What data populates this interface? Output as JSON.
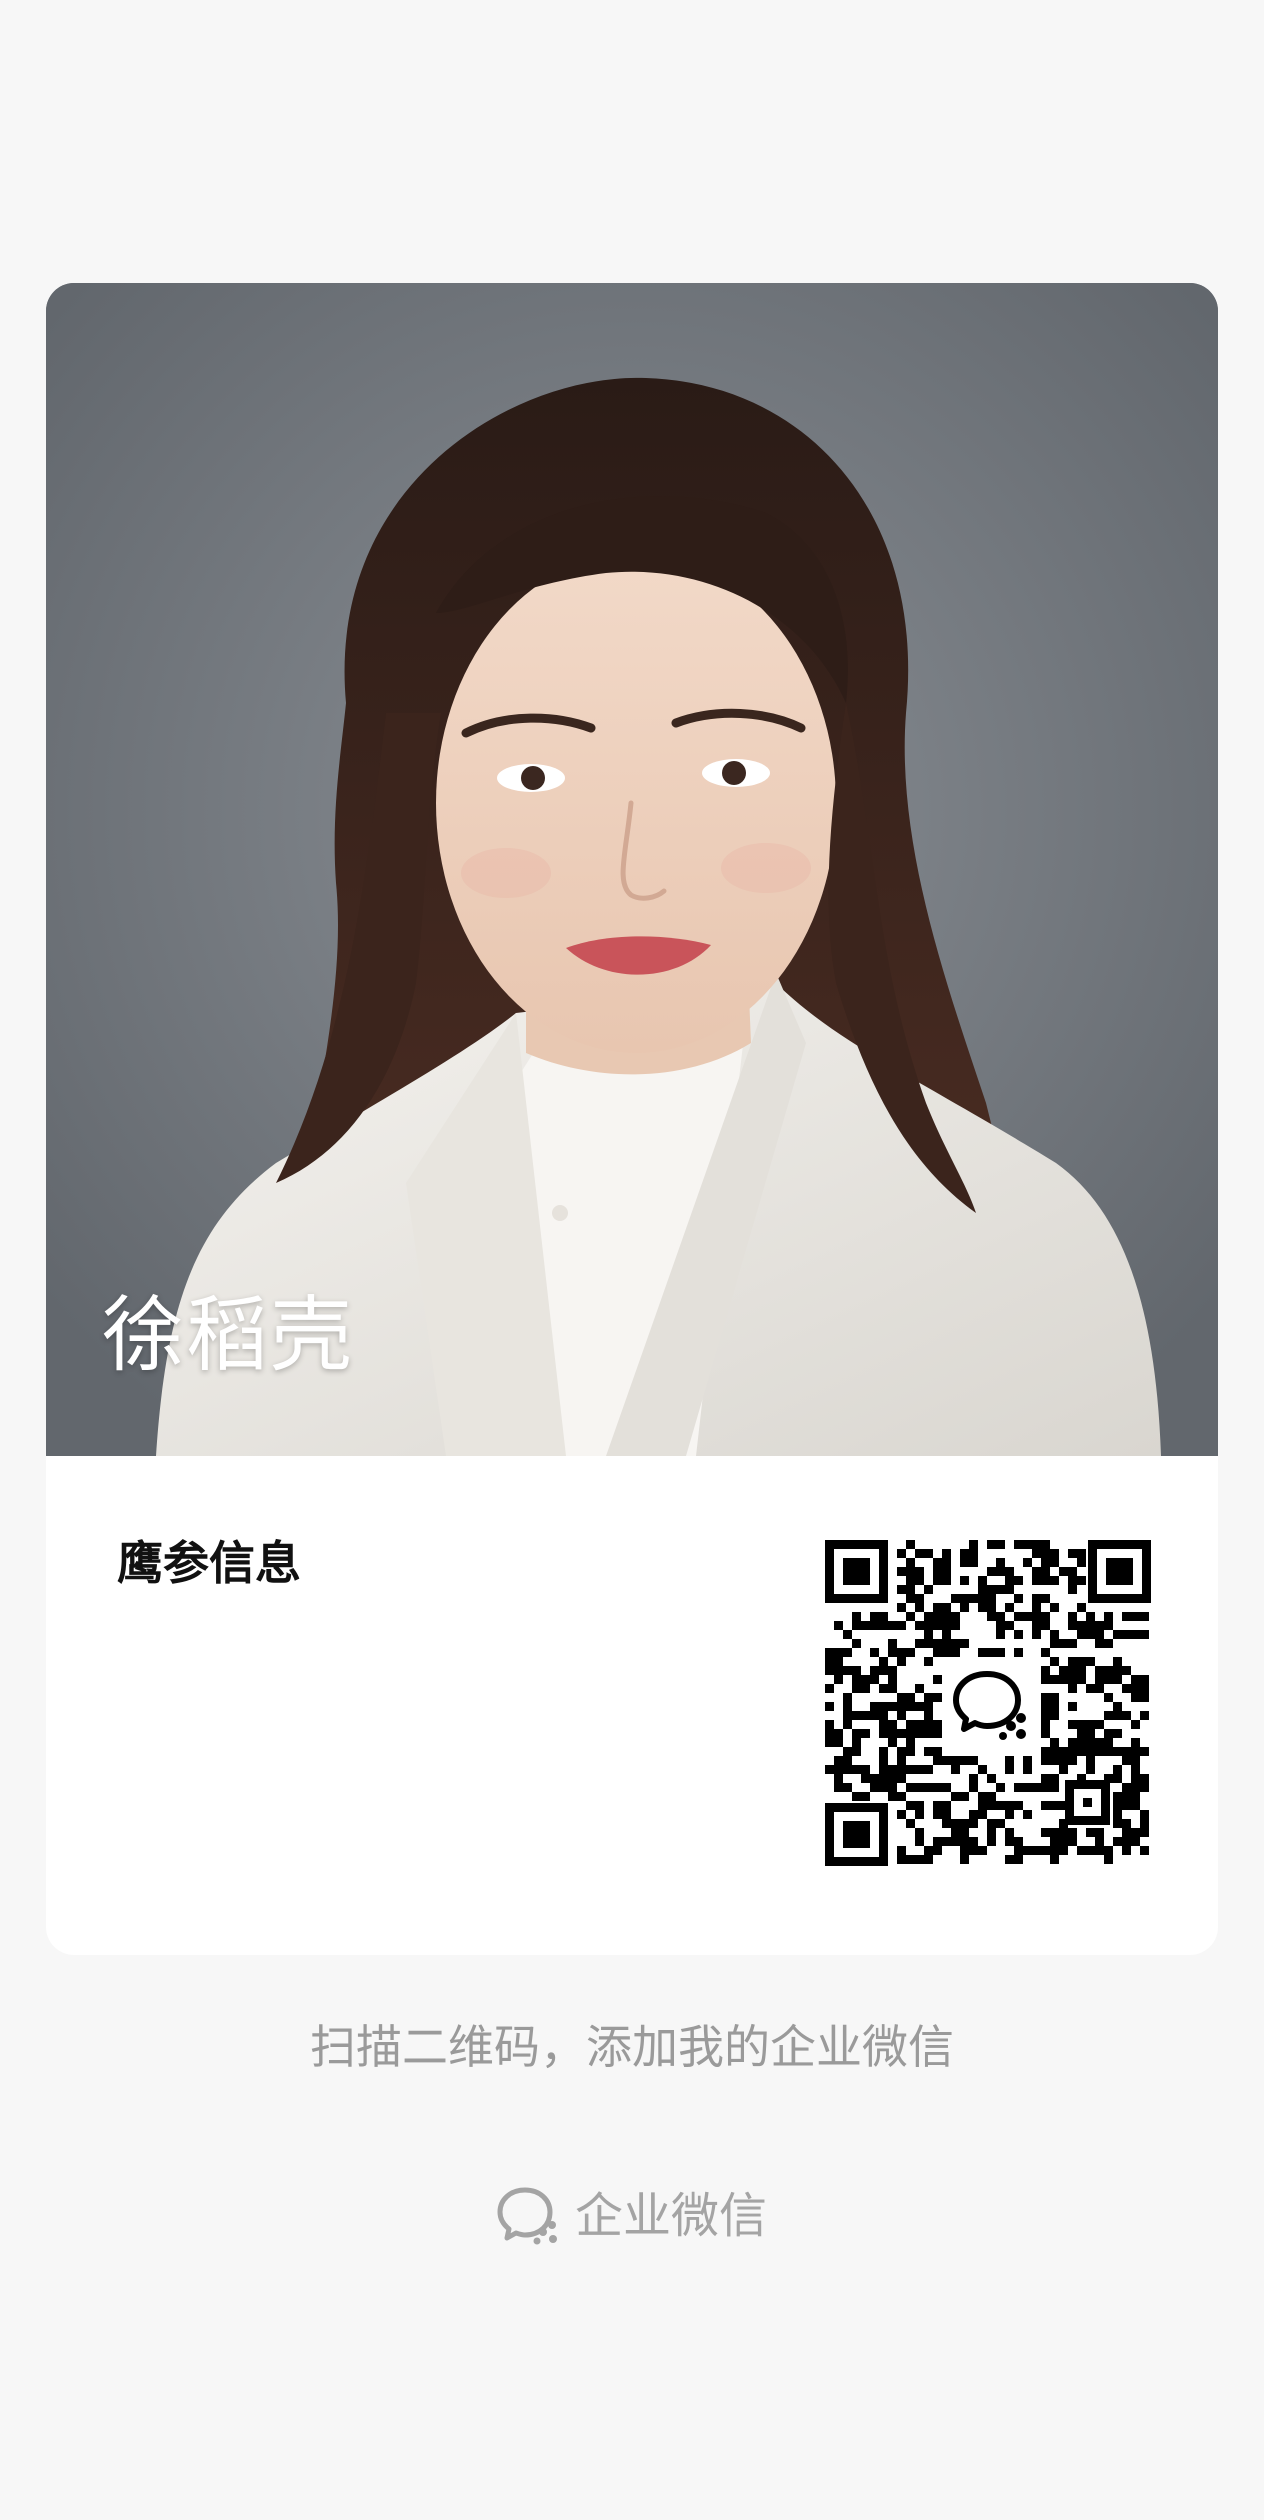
{
  "profile": {
    "name": "徐稻壳",
    "company": "鹰参信息"
  },
  "qr": {
    "icon": "wecom-logo-icon"
  },
  "hint": "扫描二维码，添加我的企业微信",
  "brand": {
    "label": "企业微信",
    "icon": "wecom-logo-icon"
  },
  "colors": {
    "background": "#f7f7f7",
    "card": "#ffffff",
    "hint_text": "#9a9a9a",
    "name_text": "#ffffff"
  }
}
